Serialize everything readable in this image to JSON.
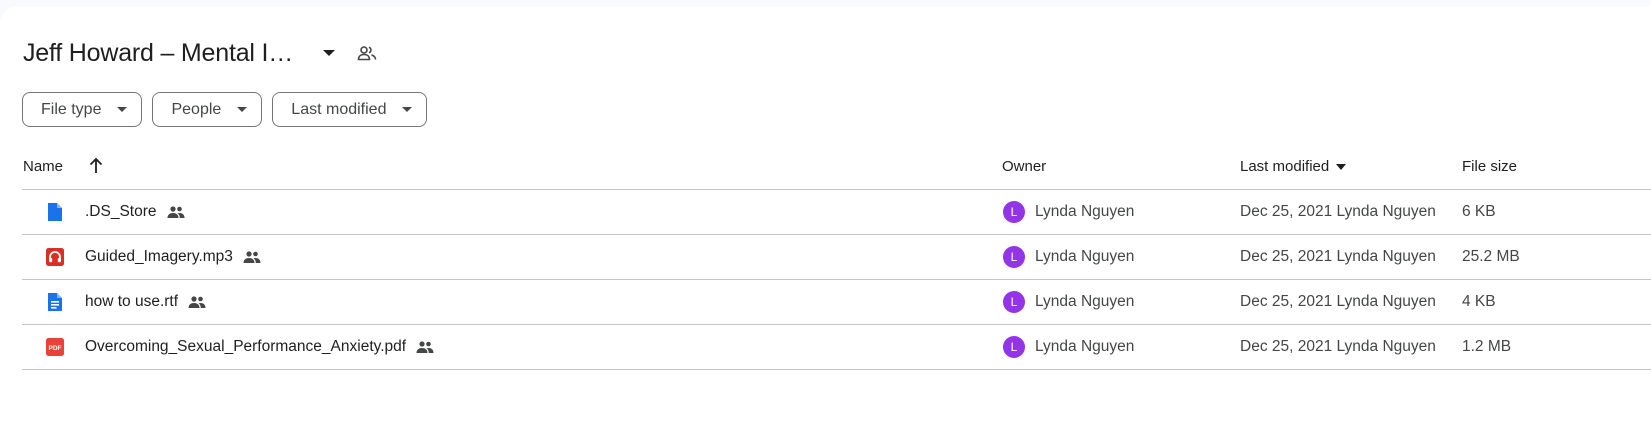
{
  "folder": {
    "title": "Jeff Howard – Mental I…",
    "dropdown_icon": "arrow-drop-down-icon",
    "shared_icon": "people-outline-icon"
  },
  "filters": [
    {
      "label": "File type"
    },
    {
      "label": "People"
    },
    {
      "label": "Last modified"
    }
  ],
  "columns": {
    "name": "Name",
    "owner": "Owner",
    "last_modified": "Last modified",
    "file_size": "File size"
  },
  "files": [
    {
      "name": ".DS_Store",
      "icon": "generic-file-icon",
      "icon_color": "#1a73e8",
      "owner": "Lynda Nguyen",
      "owner_initial": "L",
      "modified": "Dec 25, 2021 Lynda Nguyen",
      "size": "6 KB"
    },
    {
      "name": "Guided_Imagery.mp3",
      "icon": "audio-file-icon",
      "icon_color": "#d93025",
      "owner": "Lynda Nguyen",
      "owner_initial": "L",
      "modified": "Dec 25, 2021 Lynda Nguyen",
      "size": "25.2 MB"
    },
    {
      "name": "how to use.rtf",
      "icon": "document-file-icon",
      "icon_color": "#1a73e8",
      "owner": "Lynda Nguyen",
      "owner_initial": "L",
      "modified": "Dec 25, 2021 Lynda Nguyen",
      "size": "4 KB"
    },
    {
      "name": "Overcoming_Sexual_Performance_Anxiety.pdf",
      "icon": "pdf-file-icon",
      "icon_color": "#ea4335",
      "icon_text": "PDF",
      "owner": "Lynda Nguyen",
      "owner_initial": "L",
      "modified": "Dec 25, 2021 Lynda Nguyen",
      "size": "1.2 MB"
    }
  ],
  "colors": {
    "avatar": "#9334e6",
    "border": "#c4c7c5"
  }
}
